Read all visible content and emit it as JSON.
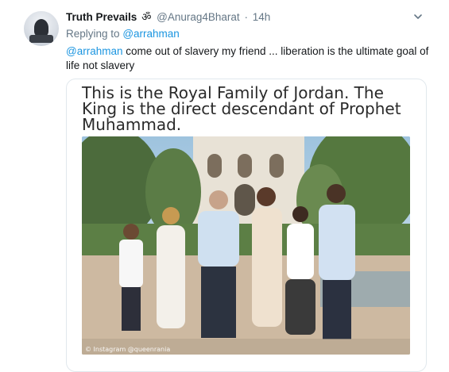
{
  "tweet": {
    "author_name": "Truth Prevails",
    "author_emoji": "ॐ",
    "handle": "@Anurag4Bharat",
    "separator": "·",
    "time": "14h",
    "reply_prefix": "Replying to",
    "reply_to": "@arrahman",
    "mention": "@arrahman",
    "body": " come out of slavery my friend ... liberation is the ultimate goal of life not slavery",
    "icons": {
      "menu": "chevron-down-icon",
      "avatar": "avatar"
    }
  },
  "media": {
    "caption": "This is the Royal Family of Jordan. The King is the direct descendant of Prophet Muhammad.",
    "watermark": "© Instagram @queenrania"
  },
  "colors": {
    "link": "#1b95e0",
    "muted": "#657786",
    "text": "#14171a",
    "border": "#e1e8ed"
  }
}
